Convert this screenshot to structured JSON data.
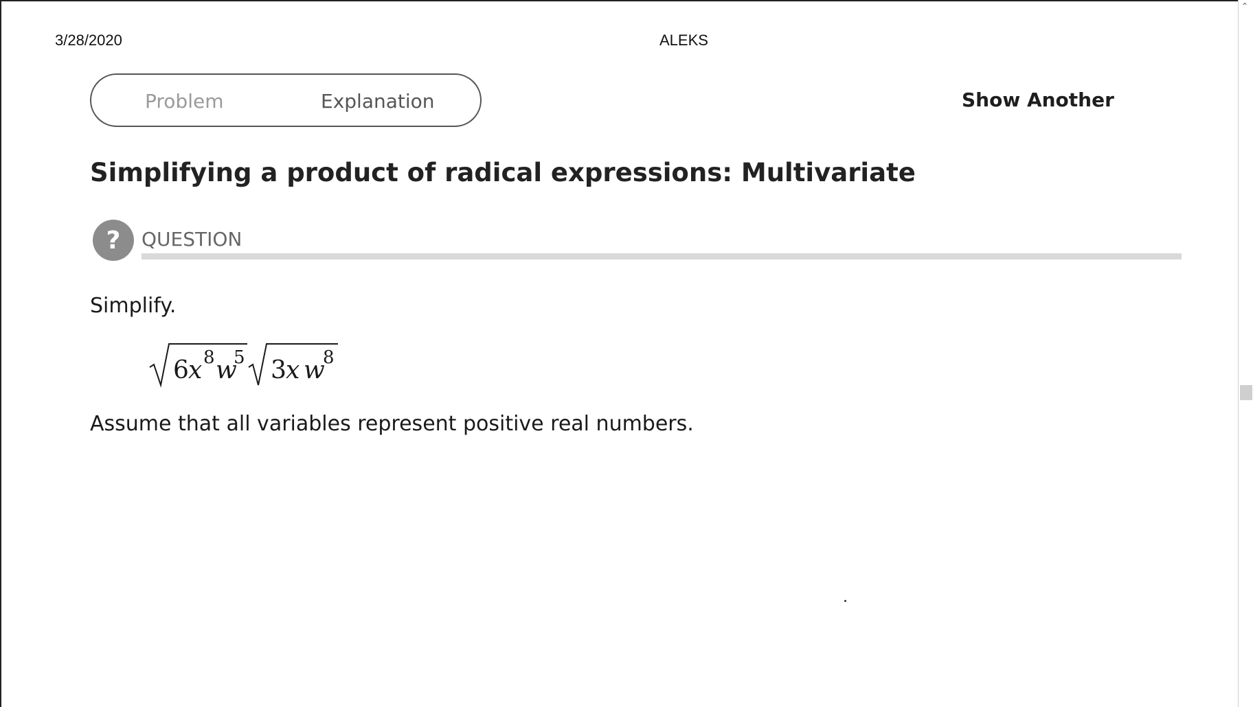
{
  "print_header": {
    "date": "3/28/2020",
    "title": "ALEKS"
  },
  "tabs": [
    {
      "label": "Problem",
      "active": false
    },
    {
      "label": "Explanation",
      "active": true
    }
  ],
  "show_another_label": "Show Another",
  "page_title": "Simplifying a product of radical expressions: Multivariate",
  "question": {
    "icon": "question-mark-icon",
    "label": "QUESTION",
    "instruction": "Simplify.",
    "expression": {
      "radical_1": {
        "coefficient": "6",
        "var1": "x",
        "exp1": "8",
        "var2": "w",
        "exp2": "5"
      },
      "radical_2": {
        "coefficient": "3",
        "var1": "x",
        "var2": "w",
        "exp2": "8"
      }
    },
    "assumption": "Assume that all variables represent positive real numbers."
  },
  "colors": {
    "icon_bg": "#8c8c8c",
    "rule": "#d9d9d9",
    "tab_border": "#555555"
  }
}
